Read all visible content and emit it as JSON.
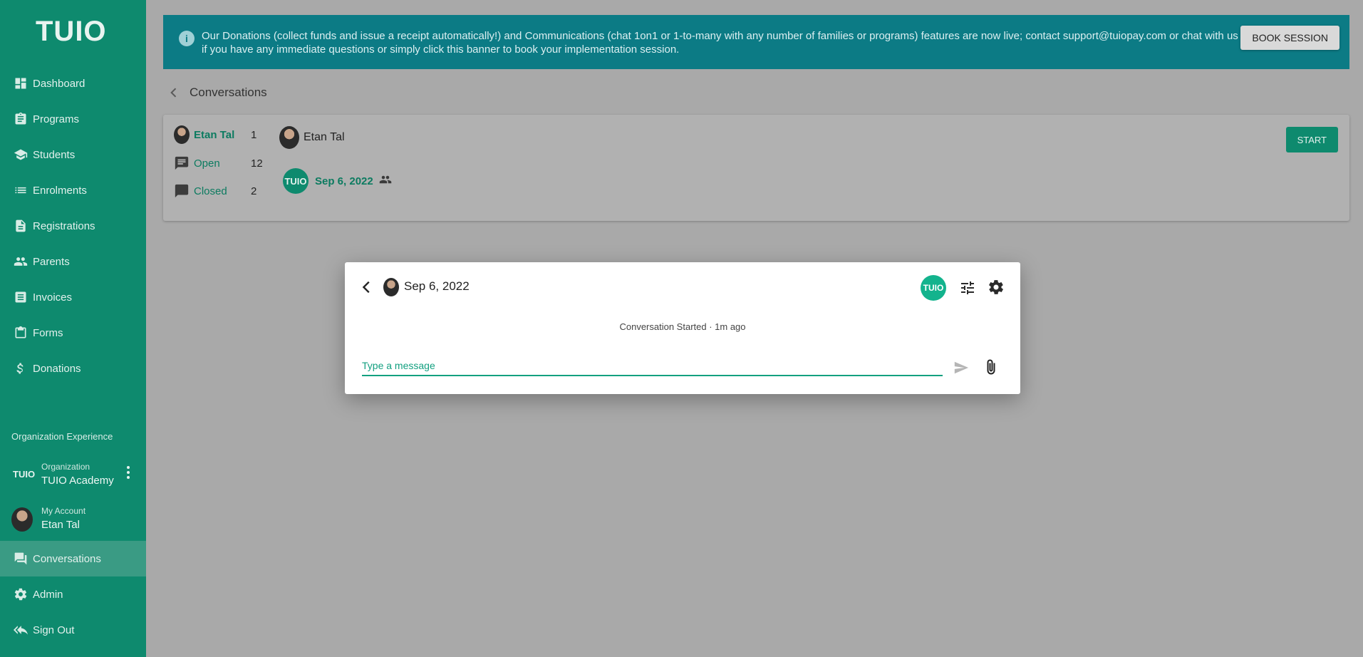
{
  "app": {
    "logo": "TUIO"
  },
  "sidebar": {
    "items": [
      {
        "label": "Dashboard",
        "icon": "dashboard-icon"
      },
      {
        "label": "Programs",
        "icon": "clipboard-icon"
      },
      {
        "label": "Students",
        "icon": "school-icon"
      },
      {
        "label": "Enrolments",
        "icon": "list-icon"
      },
      {
        "label": "Registrations",
        "icon": "document-icon"
      },
      {
        "label": "Parents",
        "icon": "people-icon"
      },
      {
        "label": "Invoices",
        "icon": "invoice-icon"
      },
      {
        "label": "Forms",
        "icon": "form-icon"
      },
      {
        "label": "Donations",
        "icon": "dollar-icon"
      }
    ],
    "section_label": "Organization Experience",
    "organization": {
      "logo": "TUIO",
      "caption": "Organization",
      "name": "TUIO Academy"
    },
    "account": {
      "caption": "My Account",
      "name": "Etan Tal"
    },
    "bottom_items": [
      {
        "label": "Conversations",
        "icon": "chat-icon",
        "active": true
      },
      {
        "label": "Admin",
        "icon": "gear-icon"
      },
      {
        "label": "Sign Out",
        "icon": "reply-all-icon"
      }
    ]
  },
  "banner": {
    "text": "Our Donations (collect funds and issue a receipt automatically!) and Communications (chat 1on1 or 1-to-many with any number of families or programs) features are now live; contact support@tuiopay.com or chat with us if you have any immediate questions or simply click this banner to book your implementation session.",
    "button": "BOOK SESSION"
  },
  "page": {
    "title": "Conversations"
  },
  "filters": {
    "user": {
      "label": "Etan Tal",
      "count": "1"
    },
    "open": {
      "label": "Open",
      "count": "12"
    },
    "closed": {
      "label": "Closed",
      "count": "2"
    }
  },
  "conversation": {
    "participant": "Etan Tal",
    "thread_badge": "TUIO",
    "thread_date": "Sep 6, 2022",
    "start_button": "START"
  },
  "modal": {
    "title": "Sep 6, 2022",
    "badge": "TUIO",
    "system_message": "Conversation Started · 1m ago",
    "input_placeholder": "Type a message",
    "input_value": ""
  },
  "colors": {
    "sidebar": "#0e8a6e",
    "banner": "#0c7b85",
    "accent": "#13a080"
  }
}
